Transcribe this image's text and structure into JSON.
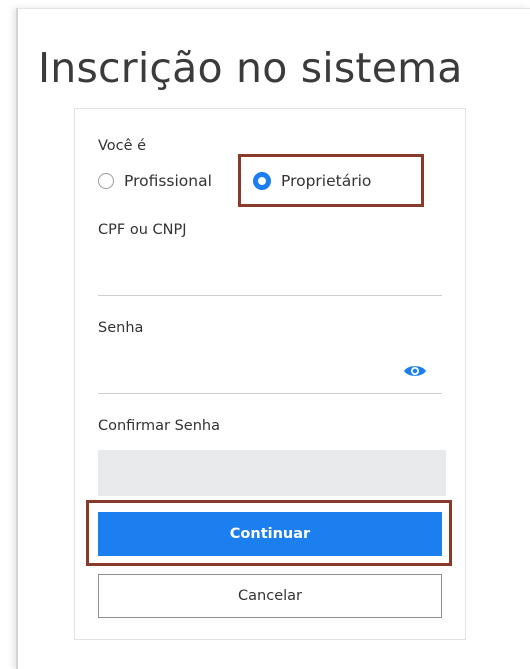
{
  "page": {
    "title": "Inscrição no sistema"
  },
  "form": {
    "user_type_label": "Você é",
    "user_type_options": [
      {
        "label": "Profissional",
        "selected": false
      },
      {
        "label": "Proprietário",
        "selected": true
      }
    ],
    "document_label": "CPF ou CNPJ",
    "document_value": "",
    "password_label": "Senha",
    "password_value": "",
    "confirm_password_label": "Confirmar Senha",
    "confirm_password_value": ""
  },
  "actions": {
    "continue_label": "Continuar",
    "cancel_label": "Cancelar"
  },
  "icons": {
    "password_toggle": "eye-icon"
  },
  "colors": {
    "accent": "#1b7ff0",
    "highlight": "#8a3a28",
    "disabled_field": "#e9eaec"
  }
}
